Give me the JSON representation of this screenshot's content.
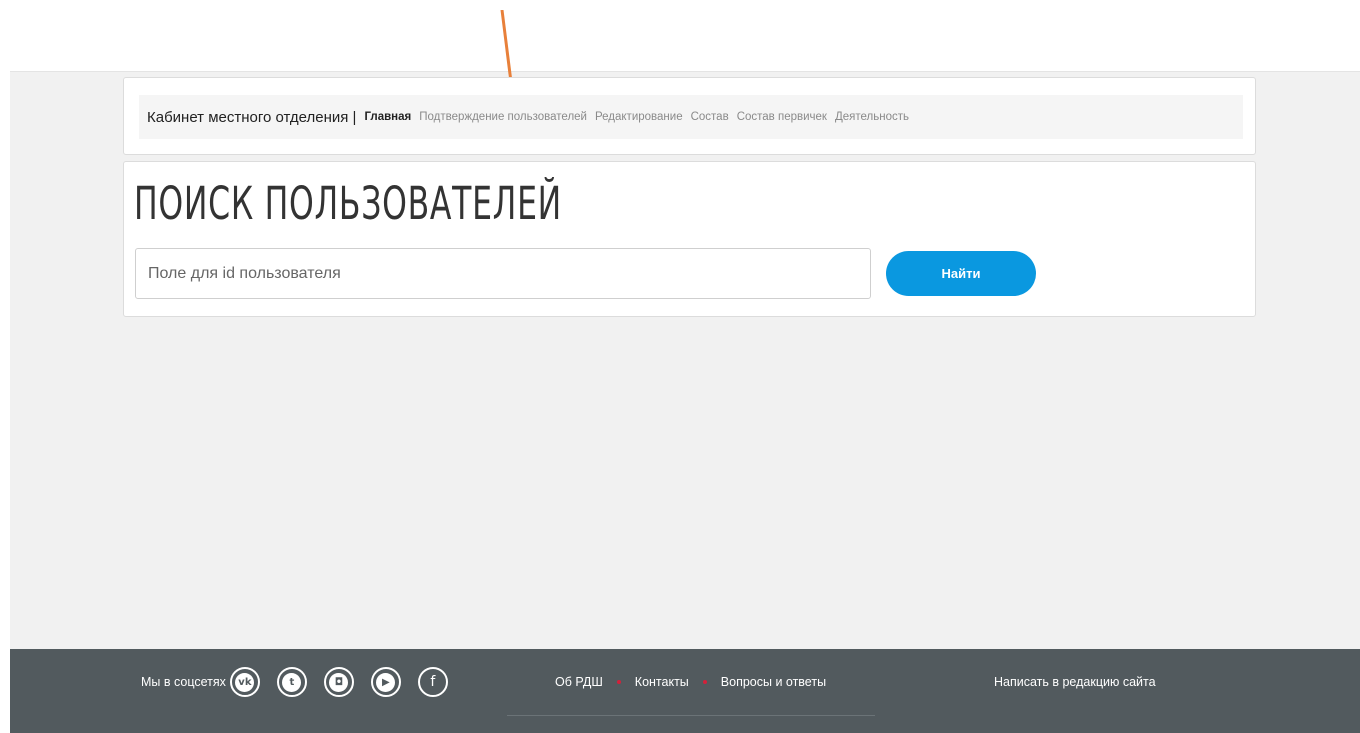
{
  "nav": {
    "title": "Кабинет местного отделения |",
    "links": [
      {
        "label": "Главная",
        "active": true
      },
      {
        "label": "Подтверждение пользователей",
        "active": false
      },
      {
        "label": "Редактирование",
        "active": false
      },
      {
        "label": "Состав",
        "active": false
      },
      {
        "label": "Состав первичек",
        "active": false
      },
      {
        "label": "Деятельность",
        "active": false
      }
    ]
  },
  "search": {
    "title": "Поиск пользователей",
    "placeholder": "Поле для id пользователя",
    "button_label": "Найти"
  },
  "footer": {
    "social_label": "Мы в соцсетях",
    "social_icons": [
      "vk-icon",
      "twitter-icon",
      "instagram-icon",
      "youtube-icon",
      "facebook-icon"
    ],
    "links": [
      "Об РДШ",
      "Контакты",
      "Вопросы и ответы"
    ],
    "write_label": "Написать в редакцию сайта"
  },
  "colors": {
    "accent": "#0a98e0",
    "footer_bg": "#525a5e",
    "footer_dot": "#d3203a",
    "annotation_arrow": "#e8803a"
  }
}
